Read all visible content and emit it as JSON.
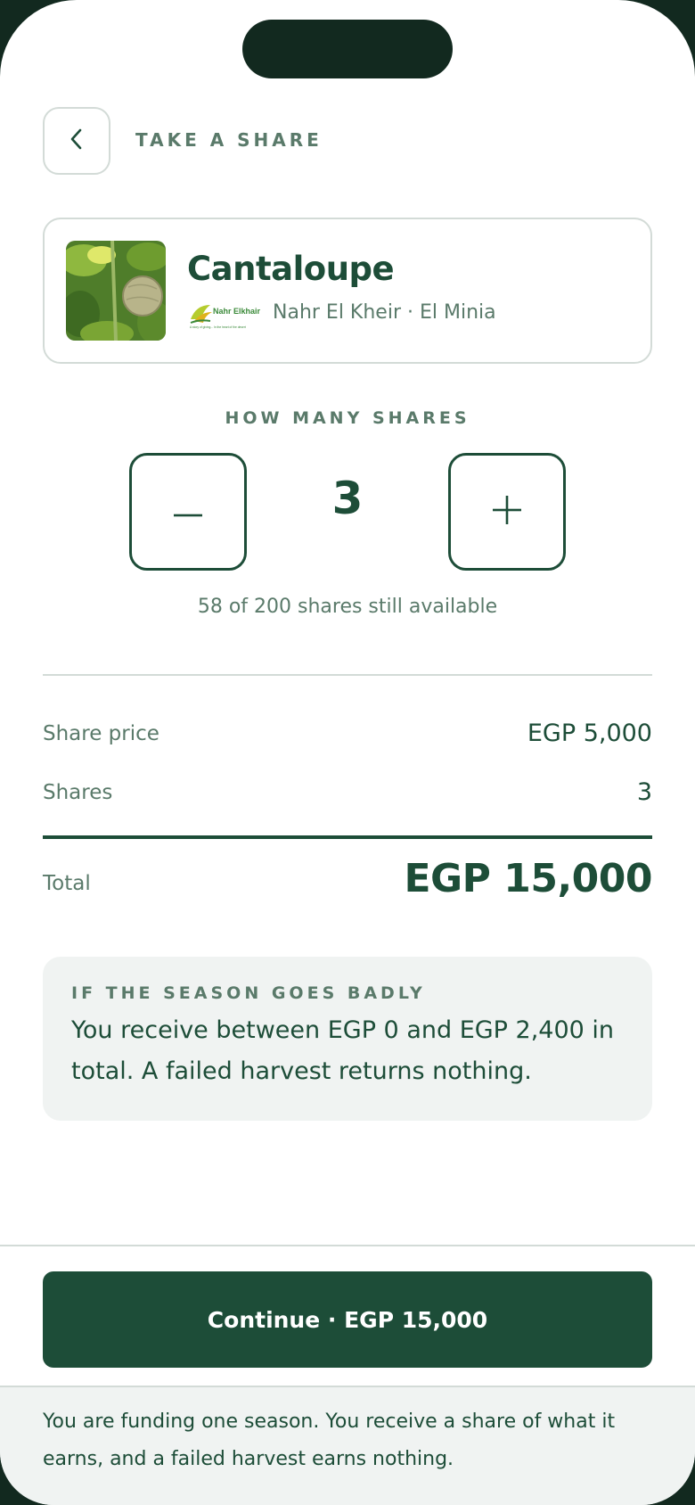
{
  "header": {
    "title": "TAKE A SHARE"
  },
  "product": {
    "name": "Cantaloupe",
    "producer_logo_text": "Nahr Elkhair",
    "producer_logo_tagline": "A story of giving... In the heart of the desert",
    "producer_line": "Nahr El Kheir · El Minia"
  },
  "selector": {
    "heading": "HOW MANY SHARES",
    "count": "3",
    "availability": "58 of 200 shares still available"
  },
  "summary": {
    "share_price_label": "Share price",
    "share_price_value": "EGP 5,000",
    "shares_label": "Shares",
    "shares_value": "3",
    "total_label": "Total",
    "total_value": "EGP 15,000"
  },
  "risk": {
    "heading": "IF THE SEASON GOES BADLY",
    "text": "You receive between EGP 0 and EGP 2,400 in total. A failed harvest returns nothing."
  },
  "cta": {
    "label": "Continue · EGP 15,000"
  },
  "footer": {
    "text": "You are funding one season. You receive a share of what it earns, and a failed harvest earns nothing."
  },
  "colors": {
    "primary": "#1d4d38",
    "muted": "#5a7a6a",
    "border": "#d3dbd7",
    "surface": "#f0f3f2",
    "device_frame": "#12291f"
  },
  "icons": {
    "back": "chevron-left-icon",
    "minus": "minus-icon",
    "plus": "plus-icon"
  }
}
